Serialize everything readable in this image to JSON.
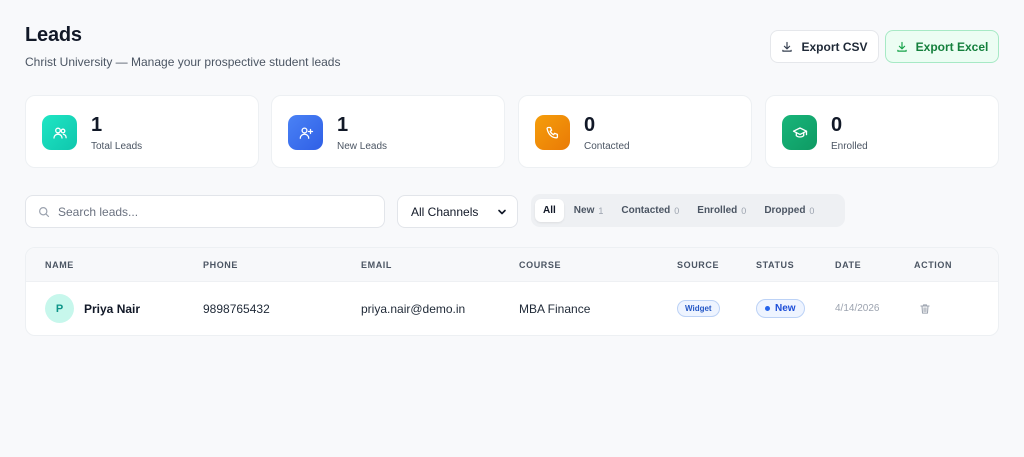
{
  "header": {
    "title": "Leads",
    "subtitle": "Christ University — Manage your prospective student leads"
  },
  "actions": {
    "export_csv": "Export CSV",
    "export_excel": "Export Excel"
  },
  "stats": [
    {
      "value": "1",
      "label": "Total Leads",
      "icon": "users-icon",
      "color": "#14d8b8"
    },
    {
      "value": "1",
      "label": "New Leads",
      "icon": "user-plus-icon",
      "color": "#3b6ff0"
    },
    {
      "value": "0",
      "label": "Contacted",
      "icon": "phone-icon",
      "color": "#f08a0a"
    },
    {
      "value": "0",
      "label": "Enrolled",
      "icon": "graduation-cap-icon",
      "color": "#12a870"
    }
  ],
  "search": {
    "placeholder": "Search leads..."
  },
  "channel_select": {
    "selected": "All Channels"
  },
  "status_filters": [
    {
      "label": "All",
      "count": ""
    },
    {
      "label": "New",
      "count": "1"
    },
    {
      "label": "Contacted",
      "count": "0"
    },
    {
      "label": "Enrolled",
      "count": "0"
    },
    {
      "label": "Dropped",
      "count": "0"
    }
  ],
  "table": {
    "columns": [
      "NAME",
      "PHONE",
      "EMAIL",
      "COURSE",
      "SOURCE",
      "STATUS",
      "DATE",
      "ACTION"
    ],
    "rows": [
      {
        "initial": "P",
        "name": "Priya Nair",
        "phone": "9898765432",
        "email": "priya.nair@demo.in",
        "course": "MBA Finance",
        "source": "Widget",
        "status": "New",
        "date": "4/14/2026"
      }
    ]
  }
}
